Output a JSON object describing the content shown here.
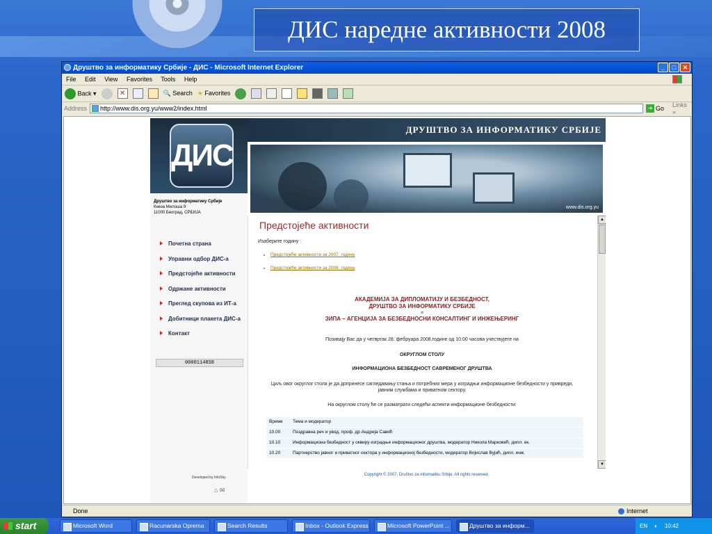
{
  "slide": {
    "title": "ДИС наредне активности 2008"
  },
  "window": {
    "title": "Друштво за информатику Србије - ДИС - Microsoft Internet Explorer"
  },
  "menu": [
    "File",
    "Edit",
    "View",
    "Favorites",
    "Tools",
    "Help"
  ],
  "toolbar": {
    "back": "Back",
    "search": "Search",
    "favorites": "Favorites"
  },
  "address": {
    "label": "Address",
    "url": "http://www.dis.org.yu/www2/index.html",
    "go": "Go",
    "links": "Links"
  },
  "site": {
    "logo": "ДИС",
    "header": "ДРУШТВО ЗА ИНФОРМАТИКУ СРБИЈЕ",
    "photo_url": "www.dis.org.yu",
    "org_address": [
      "Друштво за информатику Србије",
      "Кнеза Милоша 9",
      "11000 Београд, СРБИЈА"
    ],
    "nav": [
      "Почетна страна",
      "Управни одбор ДИС-а",
      "Предстојеће активности",
      "Одржане активности",
      "Преглед скупова из ИТ-а",
      "Добитници плакета ДИС-а",
      "Контакт"
    ],
    "counter": "00001148S8",
    "developed_by": "Developed by InfoSky",
    "copyright": "Copyright © 2007, Društvo za informatiku Srbije. All rights reserved."
  },
  "content": {
    "title": "Предстојеће активности",
    "choose": "Изаберите годину :",
    "links": [
      "Предстојеће активности за 2007. годину",
      "Предстојеће активности за 2008. годину"
    ],
    "org1": "АКАДЕМИЈА ЗА ДИПЛОМАТИЈУ И БЕЗБЕДНОСТ,",
    "org2": "ДРУШТВО ЗА ИНФОРМАТИКУ СРБИЈЕ",
    "and": "и",
    "org3": "ЗИПА – АГЕНЦИЈА ЗА БЕЗБЕДНОСНИ КОНСАЛТИНГ И ИНЖЕЊЕРИНГ",
    "invite": "Позивају  Вас да у четвртак 28. фебруара 2008.године од 10.00 часова учествујете на",
    "round": "ОКРУГЛОМ СТОЛУ",
    "topic": "ИНФОРМАЦИОНА БЕЗБЕДНОСТ САВРЕМЕНОГ ДРУШТВА",
    "goal": "Циљ овог округлог стола је да допринесе сагледавању стања и  потребних мера у изградњи информационе безбедности у привреди, јавним службама  и приватном сектору.",
    "aspects": "На округлом столу ће се разматрати следећи аспекти информационе безбедности:",
    "schedule": [
      {
        "time": "Време",
        "desc": "Тема и модератор"
      },
      {
        "time": "10.00",
        "desc": "Поздравна реч и увод, проф. др Андреја Савић"
      },
      {
        "time": "10.10",
        "desc": "Информациона безбедност у оквиру изградње информационог друштва, модератор Никола Марковић, дипл. ек."
      },
      {
        "time": "10.20",
        "desc": "Партнерство јавног и приватног сектора у информационој безбедности, модератор Војислав Вујић, дипл. инж."
      }
    ]
  },
  "status": {
    "left": "Done",
    "zone": "Internet"
  },
  "taskbar": {
    "start": "start",
    "tasks": [
      "Microsoft Word",
      "Racunarska Oprema",
      "Search Results",
      "Inbox - Outlook Express",
      "Microsoft PowerPoint ...",
      "Друштво за информ..."
    ],
    "lang": "EN",
    "clock": "10:42"
  }
}
